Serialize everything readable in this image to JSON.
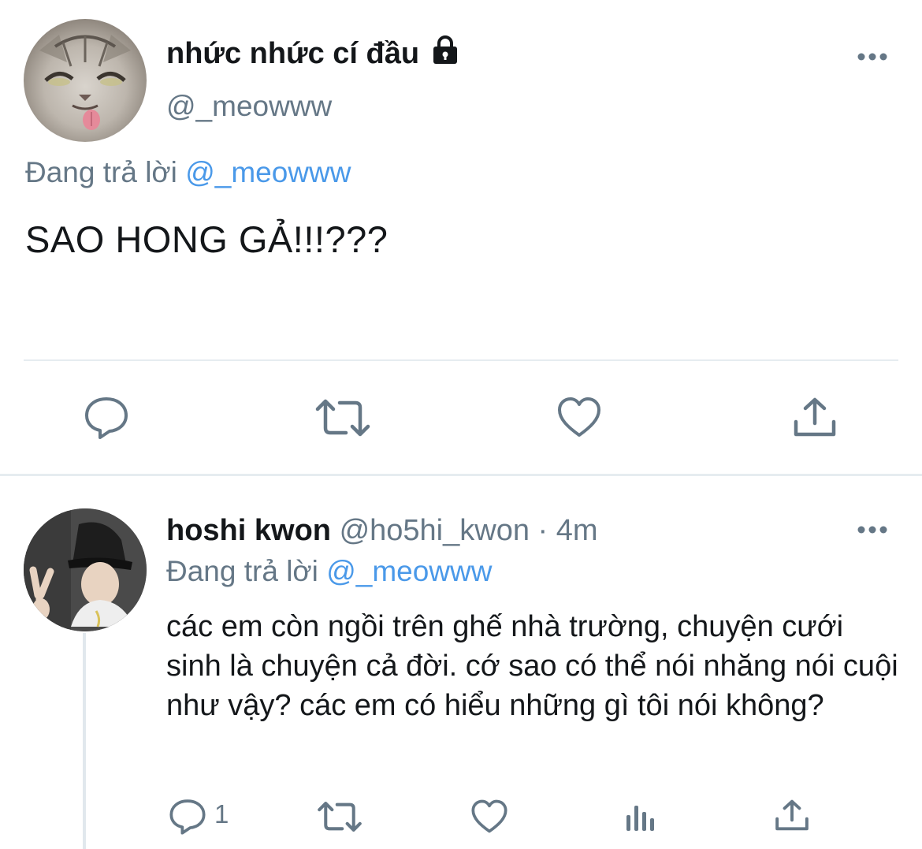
{
  "main_tweet": {
    "display_name": "nhức nhức cí đầu",
    "lock_icon": "lock-icon",
    "handle": "@_meowww",
    "replying_prefix": "Đang trả lời",
    "replying_to": "@_meowww",
    "text": "SAO HONG GẢ!!!???",
    "actions": [
      "reply-icon",
      "retweet-icon",
      "like-icon",
      "share-icon"
    ]
  },
  "reply": {
    "display_name": "hoshi kwon",
    "handle": "@ho5hi_kwon",
    "separator": "·",
    "time": "4m",
    "replying_prefix": "Đang trả lời",
    "replying_to": "@_meowww",
    "text": "các em còn ngồi trên ghế nhà trường, chuyện cưới sinh là chuyện cả đời. cớ sao có thể nói nhăng nói cuội như vậy? các em có hiểu những gì tôi nói không?",
    "reply_count": "1",
    "actions": [
      "reply-icon",
      "retweet-icon",
      "like-icon",
      "analytics-icon",
      "share-icon"
    ]
  },
  "colors": {
    "text": "#14171a",
    "secondary": "#657786",
    "link": "#4a99e9",
    "divider": "#e6ecf0"
  }
}
